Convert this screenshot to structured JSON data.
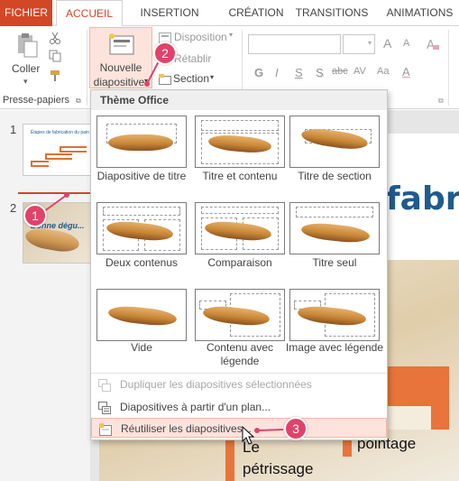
{
  "tabs": [
    "FICHIER",
    "ACCUEIL",
    "INSERTION",
    "CRÉATION",
    "TRANSITIONS",
    "ANIMATIONS"
  ],
  "ribbon": {
    "paste_label": "Coller",
    "new_slide_label_1": "Nouvelle",
    "new_slide_label_2": "diapositive",
    "layout_label": "Disposition",
    "reset_label": "Rétablir",
    "section_label": "Section",
    "clipboard_group": "Presse-papiers",
    "font_g": "G",
    "font_i": "I",
    "font_s": "S",
    "font_s2": "S",
    "font_abc": "abc",
    "font_av": "AV",
    "font_aa": "Aa",
    "font_a_up": "A",
    "font_a_down": "A"
  },
  "thumbnails": {
    "slide1_number": "1",
    "slide2_number": "2",
    "slide1_title": "Étapes de fabrication du pain",
    "slide2_title": "Bonne dégu..."
  },
  "slide": {
    "title_fragment": "fabri",
    "text_petrissage_1": "Le",
    "text_petrissage_2": "pétrissage",
    "text_pointage": "pointage"
  },
  "menu": {
    "section_title": "Thème Office",
    "layouts": [
      {
        "label": "Diapositive de titre"
      },
      {
        "label": "Titre et contenu"
      },
      {
        "label": "Titre de section"
      },
      {
        "label": "Deux contenus"
      },
      {
        "label": "Comparaison"
      },
      {
        "label": "Titre seul"
      },
      {
        "label": "Vide"
      },
      {
        "label": "Contenu avec légende"
      },
      {
        "label": "Image avec légende"
      }
    ],
    "duplicate_label": "Dupliquer les diapositives sélectionnées",
    "outline_label": "Diapositives à partir d'un plan...",
    "reuse_label": "Réutiliser les diapositives..."
  },
  "callouts": [
    "1",
    "2",
    "3"
  ],
  "colors": {
    "accent": "#d24726",
    "callout": "#e0436a",
    "title_blue": "#1f5b8e"
  }
}
